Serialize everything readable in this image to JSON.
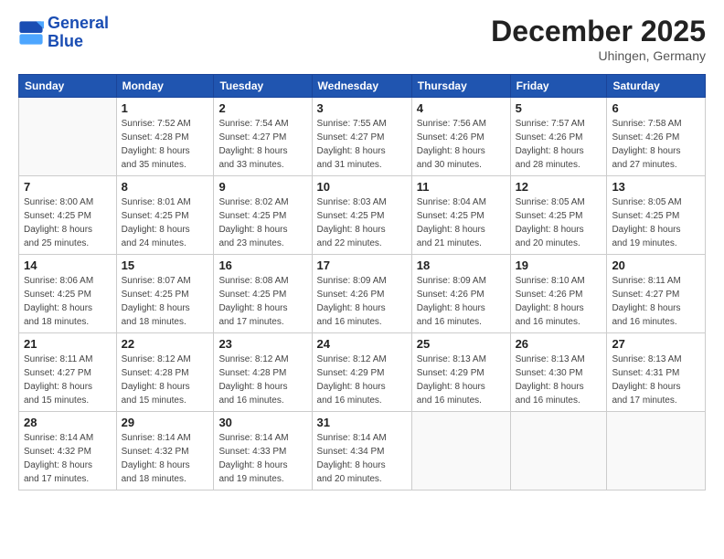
{
  "logo": {
    "line1": "General",
    "line2": "Blue"
  },
  "title": "December 2025",
  "location": "Uhingen, Germany",
  "headers": [
    "Sunday",
    "Monday",
    "Tuesday",
    "Wednesday",
    "Thursday",
    "Friday",
    "Saturday"
  ],
  "weeks": [
    [
      {
        "day": "",
        "info": ""
      },
      {
        "day": "1",
        "info": "Sunrise: 7:52 AM\nSunset: 4:28 PM\nDaylight: 8 hours\nand 35 minutes."
      },
      {
        "day": "2",
        "info": "Sunrise: 7:54 AM\nSunset: 4:27 PM\nDaylight: 8 hours\nand 33 minutes."
      },
      {
        "day": "3",
        "info": "Sunrise: 7:55 AM\nSunset: 4:27 PM\nDaylight: 8 hours\nand 31 minutes."
      },
      {
        "day": "4",
        "info": "Sunrise: 7:56 AM\nSunset: 4:26 PM\nDaylight: 8 hours\nand 30 minutes."
      },
      {
        "day": "5",
        "info": "Sunrise: 7:57 AM\nSunset: 4:26 PM\nDaylight: 8 hours\nand 28 minutes."
      },
      {
        "day": "6",
        "info": "Sunrise: 7:58 AM\nSunset: 4:26 PM\nDaylight: 8 hours\nand 27 minutes."
      }
    ],
    [
      {
        "day": "7",
        "info": "Sunrise: 8:00 AM\nSunset: 4:25 PM\nDaylight: 8 hours\nand 25 minutes."
      },
      {
        "day": "8",
        "info": "Sunrise: 8:01 AM\nSunset: 4:25 PM\nDaylight: 8 hours\nand 24 minutes."
      },
      {
        "day": "9",
        "info": "Sunrise: 8:02 AM\nSunset: 4:25 PM\nDaylight: 8 hours\nand 23 minutes."
      },
      {
        "day": "10",
        "info": "Sunrise: 8:03 AM\nSunset: 4:25 PM\nDaylight: 8 hours\nand 22 minutes."
      },
      {
        "day": "11",
        "info": "Sunrise: 8:04 AM\nSunset: 4:25 PM\nDaylight: 8 hours\nand 21 minutes."
      },
      {
        "day": "12",
        "info": "Sunrise: 8:05 AM\nSunset: 4:25 PM\nDaylight: 8 hours\nand 20 minutes."
      },
      {
        "day": "13",
        "info": "Sunrise: 8:05 AM\nSunset: 4:25 PM\nDaylight: 8 hours\nand 19 minutes."
      }
    ],
    [
      {
        "day": "14",
        "info": "Sunrise: 8:06 AM\nSunset: 4:25 PM\nDaylight: 8 hours\nand 18 minutes."
      },
      {
        "day": "15",
        "info": "Sunrise: 8:07 AM\nSunset: 4:25 PM\nDaylight: 8 hours\nand 18 minutes."
      },
      {
        "day": "16",
        "info": "Sunrise: 8:08 AM\nSunset: 4:25 PM\nDaylight: 8 hours\nand 17 minutes."
      },
      {
        "day": "17",
        "info": "Sunrise: 8:09 AM\nSunset: 4:26 PM\nDaylight: 8 hours\nand 16 minutes."
      },
      {
        "day": "18",
        "info": "Sunrise: 8:09 AM\nSunset: 4:26 PM\nDaylight: 8 hours\nand 16 minutes."
      },
      {
        "day": "19",
        "info": "Sunrise: 8:10 AM\nSunset: 4:26 PM\nDaylight: 8 hours\nand 16 minutes."
      },
      {
        "day": "20",
        "info": "Sunrise: 8:11 AM\nSunset: 4:27 PM\nDaylight: 8 hours\nand 16 minutes."
      }
    ],
    [
      {
        "day": "21",
        "info": "Sunrise: 8:11 AM\nSunset: 4:27 PM\nDaylight: 8 hours\nand 15 minutes."
      },
      {
        "day": "22",
        "info": "Sunrise: 8:12 AM\nSunset: 4:28 PM\nDaylight: 8 hours\nand 15 minutes."
      },
      {
        "day": "23",
        "info": "Sunrise: 8:12 AM\nSunset: 4:28 PM\nDaylight: 8 hours\nand 16 minutes."
      },
      {
        "day": "24",
        "info": "Sunrise: 8:12 AM\nSunset: 4:29 PM\nDaylight: 8 hours\nand 16 minutes."
      },
      {
        "day": "25",
        "info": "Sunrise: 8:13 AM\nSunset: 4:29 PM\nDaylight: 8 hours\nand 16 minutes."
      },
      {
        "day": "26",
        "info": "Sunrise: 8:13 AM\nSunset: 4:30 PM\nDaylight: 8 hours\nand 16 minutes."
      },
      {
        "day": "27",
        "info": "Sunrise: 8:13 AM\nSunset: 4:31 PM\nDaylight: 8 hours\nand 17 minutes."
      }
    ],
    [
      {
        "day": "28",
        "info": "Sunrise: 8:14 AM\nSunset: 4:32 PM\nDaylight: 8 hours\nand 17 minutes."
      },
      {
        "day": "29",
        "info": "Sunrise: 8:14 AM\nSunset: 4:32 PM\nDaylight: 8 hours\nand 18 minutes."
      },
      {
        "day": "30",
        "info": "Sunrise: 8:14 AM\nSunset: 4:33 PM\nDaylight: 8 hours\nand 19 minutes."
      },
      {
        "day": "31",
        "info": "Sunrise: 8:14 AM\nSunset: 4:34 PM\nDaylight: 8 hours\nand 20 minutes."
      },
      {
        "day": "",
        "info": ""
      },
      {
        "day": "",
        "info": ""
      },
      {
        "day": "",
        "info": ""
      }
    ]
  ]
}
